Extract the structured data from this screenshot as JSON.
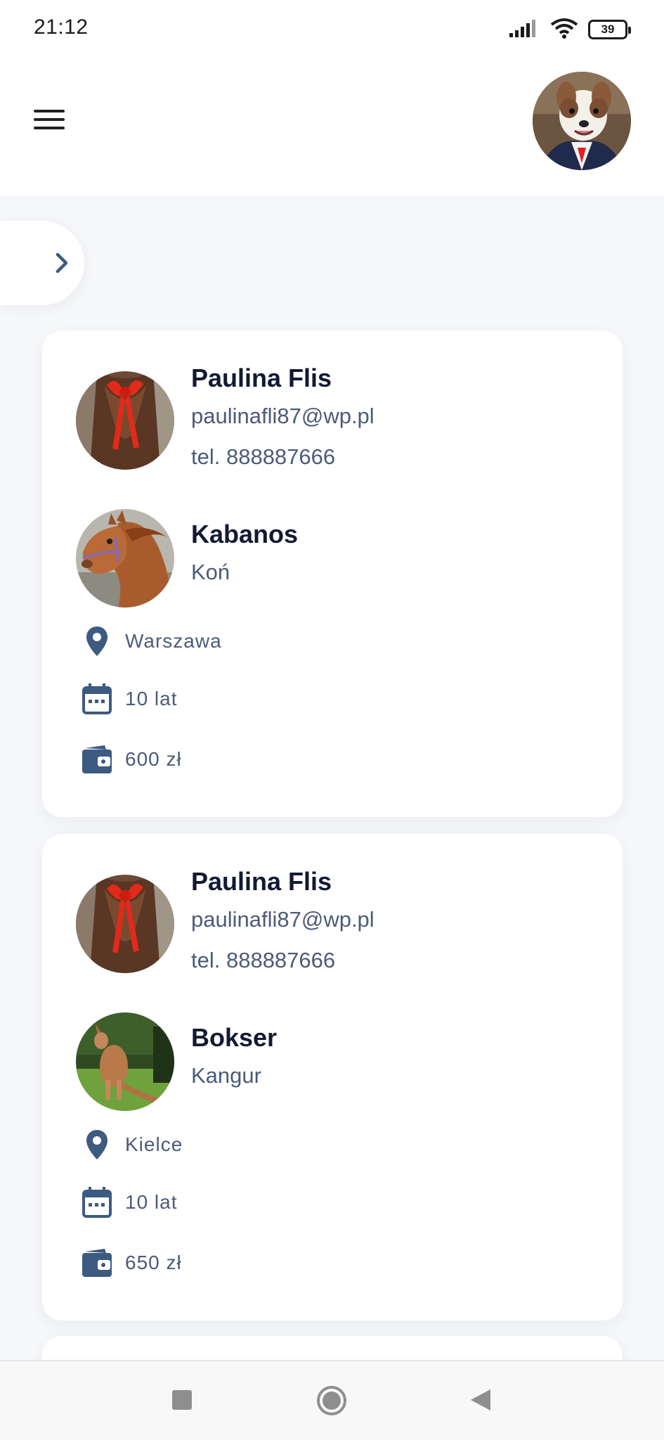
{
  "status_bar": {
    "time": "21:12",
    "battery": "39",
    "icons": [
      "signal-icon",
      "wifi-icon",
      "battery-icon"
    ]
  },
  "app_bar": {
    "menu_icon": "hamburger-menu-icon",
    "profile_avatar": "user-profile-avatar"
  },
  "drawer": {
    "icon": "chevron-right-icon"
  },
  "listings": [
    {
      "owner_name": "Paulina Flis",
      "owner_email": "paulinafli87@wp.pl",
      "owner_phone": "tel. 888887666",
      "pet_name": "Kabanos",
      "pet_species": "Koń",
      "location": "Warszawa",
      "age": "10 lat",
      "price": "600 zł"
    },
    {
      "owner_name": "Paulina Flis",
      "owner_email": "paulinafli87@wp.pl",
      "owner_phone": "tel. 888887666",
      "pet_name": "Bokser",
      "pet_species": "Kangur",
      "location": "Kielce",
      "age": "10 lat",
      "price": "650 zł"
    }
  ],
  "colors": {
    "accent": "#3d5a80",
    "title": "#121a33",
    "subtitle": "#4b5b7a",
    "background": "#f6f7fa"
  },
  "nav_bar": {
    "icons": [
      "recents-square-icon",
      "home-circle-icon",
      "back-triangle-icon"
    ]
  }
}
